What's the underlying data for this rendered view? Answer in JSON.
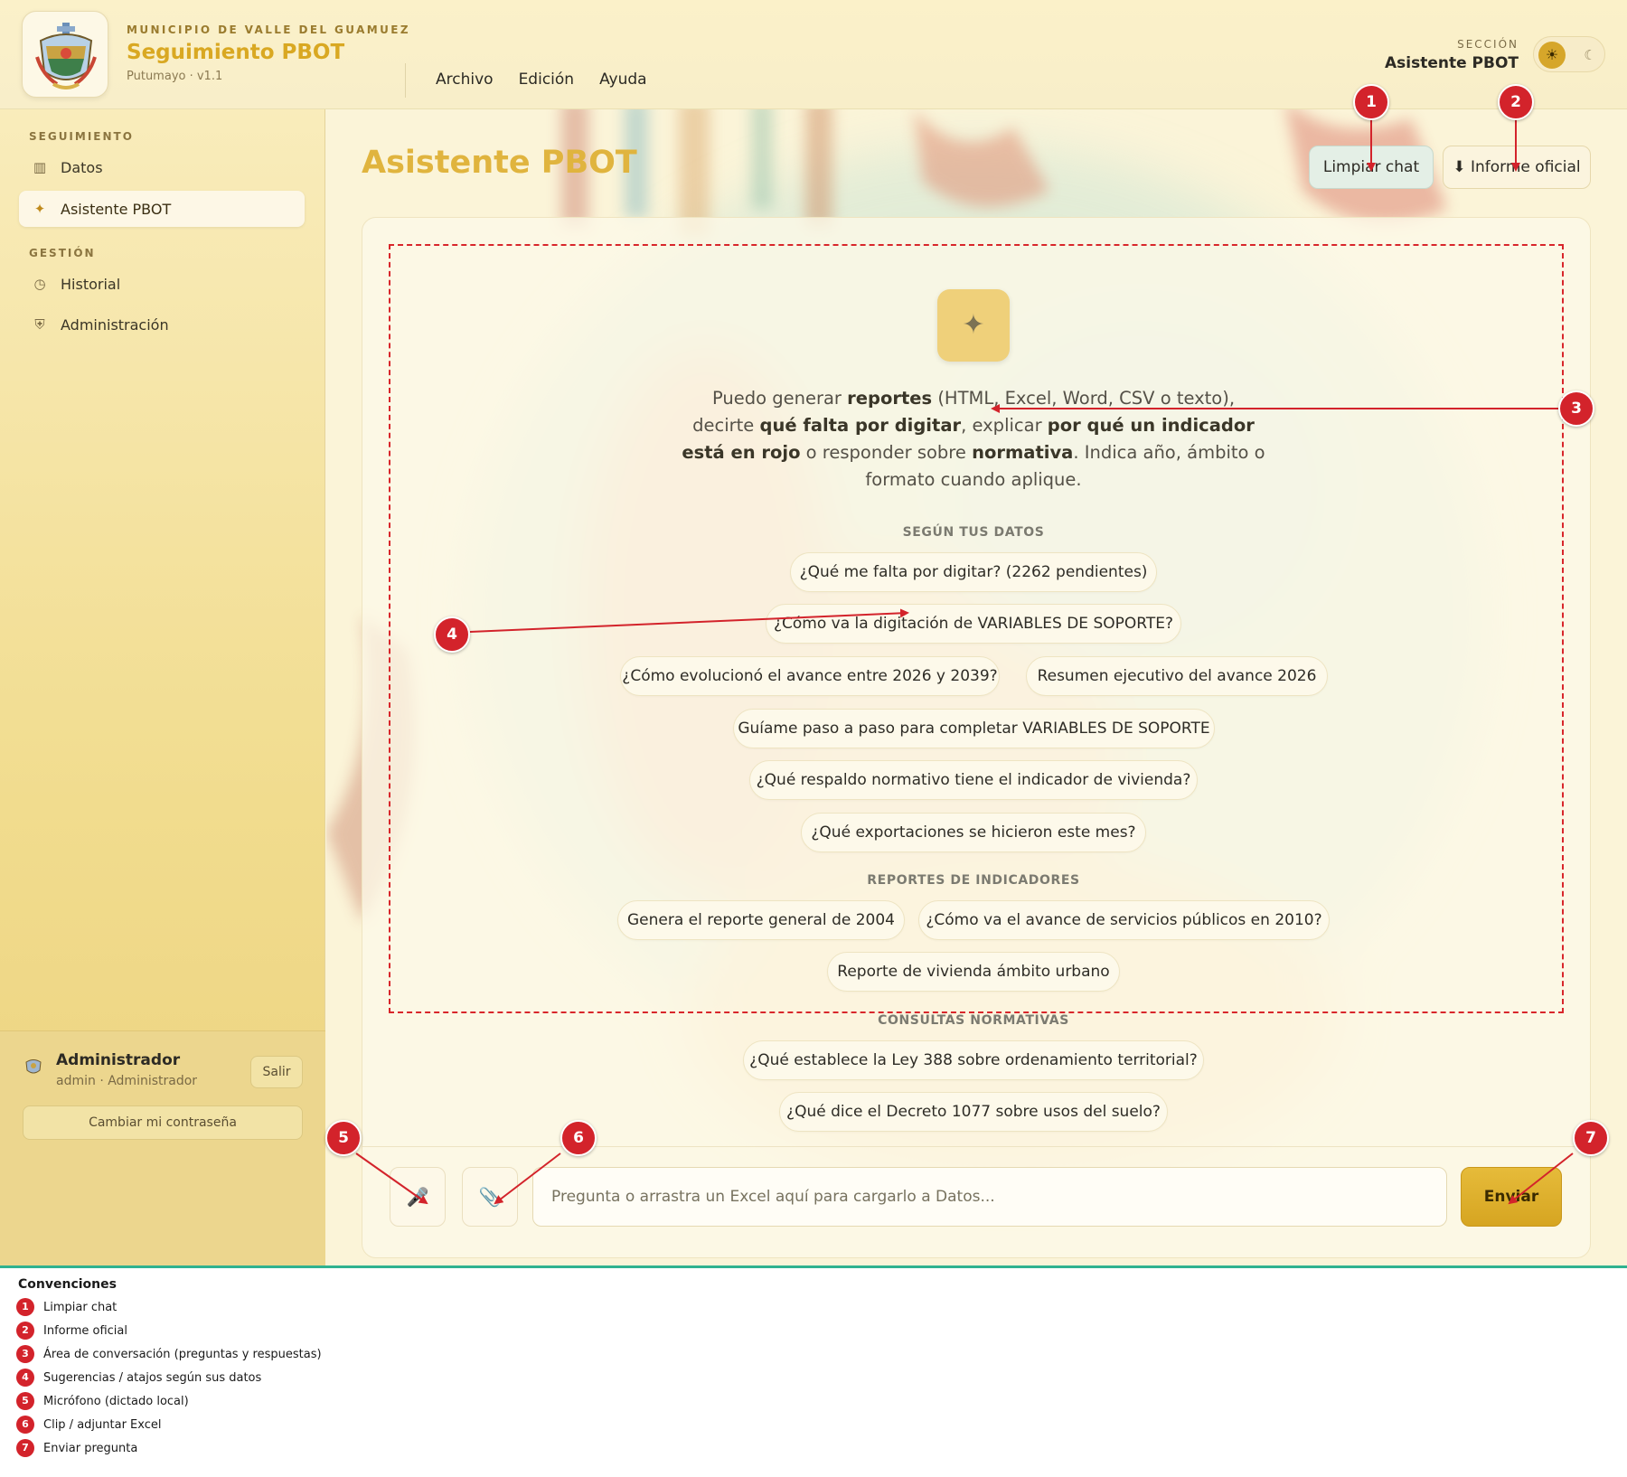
{
  "header": {
    "org": "MUNICIPIO DE VALLE DEL GUAMUEZ",
    "title": "Seguimiento PBOT",
    "subtitle": "Putumayo · v1.1",
    "menu": [
      "Archivo",
      "Edición",
      "Ayuda"
    ],
    "section_label": "SECCIÓN",
    "section_value": "Asistente PBOT",
    "theme_icons": {
      "light": "☀",
      "dark": "☾"
    }
  },
  "sidebar": {
    "groups": [
      {
        "label": "SEGUIMIENTO",
        "items": [
          {
            "icon": "grid-icon",
            "label": "Datos"
          },
          {
            "icon": "sparkle-icon",
            "label": "Asistente PBOT",
            "active": true
          }
        ]
      },
      {
        "label": "GESTIÓN",
        "items": [
          {
            "icon": "clock-icon",
            "label": "Historial"
          },
          {
            "icon": "shield-icon",
            "label": "Administración"
          }
        ]
      }
    ],
    "user": {
      "name": "Administrador",
      "role": "admin · Administrador",
      "logout": "Salir",
      "change_password": "Cambiar mi contraseña"
    }
  },
  "main": {
    "title": "Asistente PBOT",
    "btn_clear": "Limpiar chat",
    "btn_report": "⬇ Informe oficial",
    "spark_glyph": "✦",
    "intro": {
      "p1": "Puedo generar ",
      "b1": "reportes",
      "p2": " (HTML, Excel, Word, CSV o texto), decirte ",
      "b2": "qué falta por digitar",
      "p3": ", explicar ",
      "b3": "por qué un indicador está en rojo",
      "p4": " o responder sobre ",
      "b4": "normativa",
      "p5": ". Indica año, ámbito o formato cuando aplique."
    },
    "sections": [
      {
        "heading": "SEGÚN TUS DATOS",
        "chips": [
          "¿Qué me falta por digitar? (2262 pendientes)",
          "¿Cómo va la digitación de VARIABLES DE SOPORTE?",
          "¿Cómo evolucionó el avance entre 2026 y 2039?",
          "Resumen ejecutivo del avance 2026",
          "Guíame paso a paso para completar VARIABLES DE SOPORTE",
          "¿Qué respaldo normativo tiene el indicador de vivienda?",
          "¿Qué exportaciones se hicieron este mes?"
        ]
      },
      {
        "heading": "REPORTES DE INDICADORES",
        "chips": [
          "Genera el reporte general de 2004",
          "¿Cómo va el avance de servicios públicos en 2010?",
          "Reporte de vivienda ámbito urbano"
        ]
      },
      {
        "heading": "CONSULTAS NORMATIVAS",
        "chips": [
          "¿Qué establece la Ley 388 sobre ordenamiento territorial?",
          "¿Qué dice el Decreto 1077 sobre usos del suelo?"
        ]
      }
    ],
    "composer": {
      "mic_icon": "🎤",
      "clip_icon": "📎",
      "placeholder": "Pregunta o arrastra un Excel aquí para cargarlo a Datos...",
      "send": "Enviar"
    }
  },
  "annotations": {
    "markers": [
      "1",
      "2",
      "3",
      "4",
      "5",
      "6",
      "7"
    ]
  },
  "legend": {
    "title": "Convenciones",
    "items": [
      {
        "n": "1",
        "text": "Limpiar chat"
      },
      {
        "n": "2",
        "text": "Informe oficial"
      },
      {
        "n": "3",
        "text": "Área de conversación (preguntas y respuestas)"
      },
      {
        "n": "4",
        "text": "Sugerencias / atajos según sus datos"
      },
      {
        "n": "5",
        "text": "Micrófono (dictado local)"
      },
      {
        "n": "6",
        "text": "Clip / adjuntar Excel"
      },
      {
        "n": "7",
        "text": "Enviar pregunta"
      }
    ]
  },
  "colors": {
    "accent": "#d9a822",
    "annotation": "#d3232b",
    "legend_rule": "#2fb28f"
  }
}
